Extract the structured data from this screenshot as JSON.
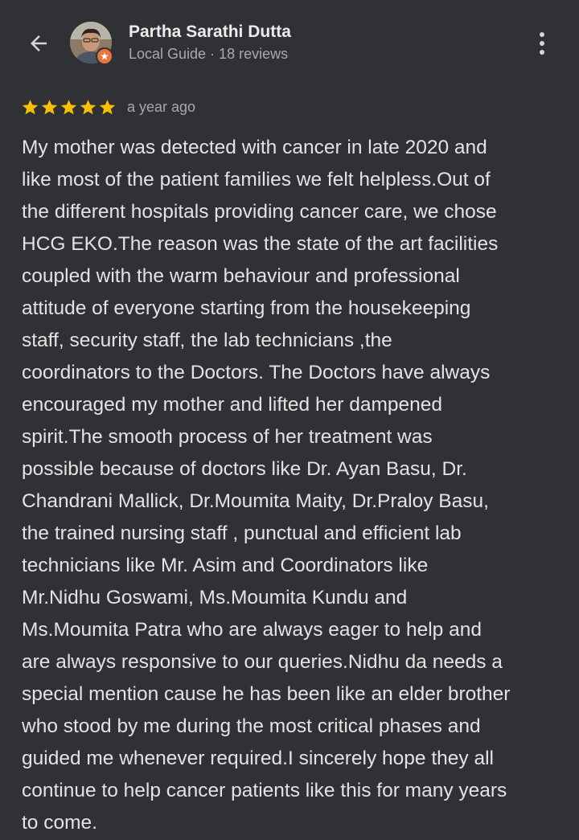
{
  "reviewer": {
    "name": "Partha Sarathi Dutta",
    "meta": "Local Guide · 18 reviews"
  },
  "icons": {
    "back": "arrow-left-icon",
    "more": "more-vertical-icon",
    "badge": "local-guide-badge-icon",
    "star": "star-icon"
  },
  "rating": {
    "stars": 5,
    "max": 5,
    "time": "a year ago"
  },
  "colors": {
    "background": "#303134",
    "star": "#fbbc04",
    "badge": "#e8763a",
    "text_primary": "#e3e3e3",
    "text_secondary": "#a8a9ac"
  },
  "review_lines": [
    "My mother was detected with cancer in late 2020 and",
    "like most of the patient families we felt helpless.Out of",
    "the different hospitals providing cancer care, we chose",
    "HCG EKO.The reason was the state of the art facilities",
    "coupled with the warm behaviour and professional",
    "attitude of everyone starting from the housekeeping",
    "staff, security staff, the lab technicians ,the",
    "coordinators to the Doctors. The Doctors have always",
    "encouraged my mother and lifted her dampened",
    "spirit.The smooth process of her treatment was",
    "possible because of doctors like Dr. Ayan Basu, Dr.",
    "Chandrani Mallick, Dr.Moumita Maity, Dr.Praloy Basu,",
    "the trained nursing staff , punctual and efficient lab",
    "technicians like Mr. Asim and Coordinators like",
    "Mr.Nidhu Goswami, Ms.Moumita Kundu and",
    "Ms.Moumita Patra who are always eager to help and",
    "are always responsive to our queries.Nidhu da needs a",
    "special mention cause he has been like an elder brother",
    "who stood by me during the most critical phases and",
    "guided me whenever required.I sincerely hope they all",
    "continue to help cancer patients like this for many years",
    "to come."
  ]
}
